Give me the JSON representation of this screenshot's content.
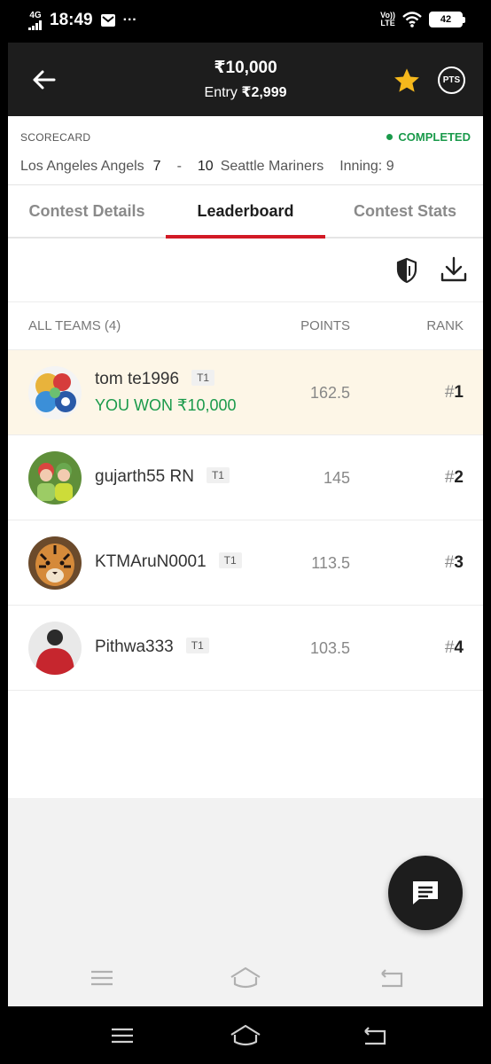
{
  "status_bar": {
    "network": "4G",
    "time": "18:49",
    "more": "···",
    "volte_top": "Vo))",
    "volte_bottom": "LTE",
    "battery": "42"
  },
  "header": {
    "prize": "₹10,000",
    "entry_label": "Entry",
    "entry_fee": "₹2,999",
    "pts_label": "PTS",
    "star_color": "#f5b81c"
  },
  "scorecard": {
    "label": "SCORECARD",
    "status": "COMPLETED",
    "team1": "Los Angeles Angels",
    "score1": "7",
    "separator": "-",
    "score2": "10",
    "team2": "Seattle Mariners",
    "inning": "Inning: 9"
  },
  "tabs": [
    {
      "label": "Contest Details"
    },
    {
      "label": "Leaderboard"
    },
    {
      "label": "Contest Stats"
    }
  ],
  "active_tab": "Leaderboard",
  "leaderboard": {
    "col_teams": "ALL TEAMS (4)",
    "col_points": "POINTS",
    "col_rank": "RANK",
    "rows": [
      {
        "name": "tom te1996",
        "team": "T1",
        "won": "YOU WON ₹10,000",
        "points": "162.5",
        "rank_hash": "#",
        "rank": "1"
      },
      {
        "name": "gujarth55 RN",
        "team": "T1",
        "points": "145",
        "rank_hash": "#",
        "rank": "2"
      },
      {
        "name": "KTMAruN0001",
        "team": "T1",
        "points": "113.5",
        "rank_hash": "#",
        "rank": "3"
      },
      {
        "name": "Pithwa333",
        "team": "T1",
        "points": "103.5",
        "rank_hash": "#",
        "rank": "4"
      }
    ]
  },
  "colors": {
    "accent_red": "#d21a25",
    "success_green": "#1a9a4b",
    "header_bg": "#1d1d1d",
    "winner_row_bg": "#fdf6e7"
  },
  "icons": [
    "back-arrow-icon",
    "star-icon",
    "compare-shield-icon",
    "download-icon",
    "chat-icon",
    "menu-icon",
    "home-icon",
    "back-nav-icon"
  ]
}
